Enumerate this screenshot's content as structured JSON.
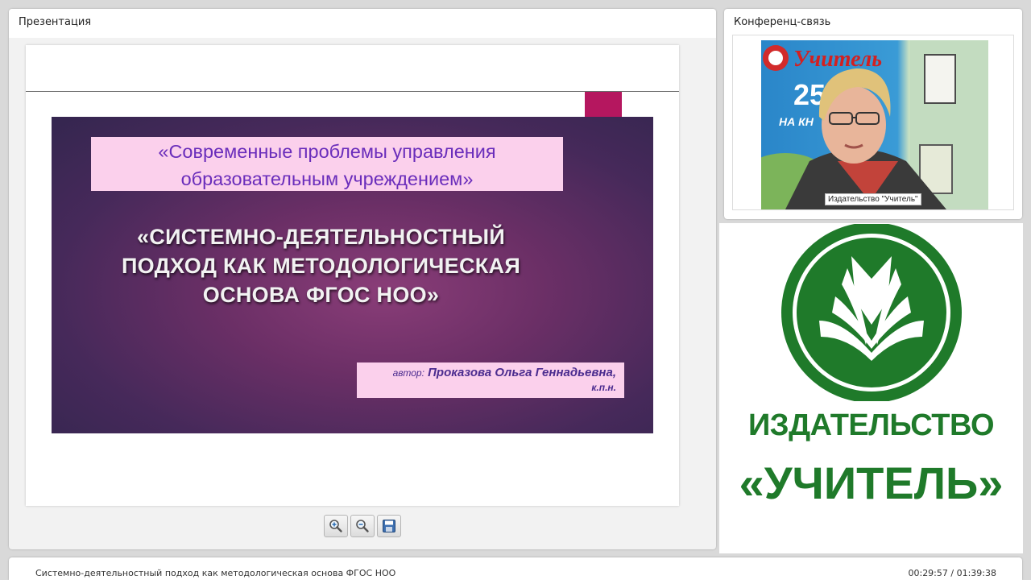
{
  "presentation": {
    "panel_title": "Презентация",
    "slide": {
      "subtitle_line1": "«Современные проблемы управления",
      "subtitle_line2": "образовательным учреждением»",
      "title_line1": "«СИСТЕМНО-ДЕЯТЕЛЬНОСТНЫЙ",
      "title_line2": "ПОДХОД КАК МЕТОДОЛОГИЧЕСКАЯ",
      "title_line3": "ОСНОВА ФГОС НОО»",
      "author_label": "автор:",
      "author_name": "Проказова Ольга Геннадьевна",
      "author_degree": "к.п.н."
    },
    "toolbar": {
      "zoom_in": "zoom-in-icon",
      "zoom_out": "zoom-out-icon",
      "save": "save-icon"
    }
  },
  "conference": {
    "panel_title": "Конференц-связь",
    "video_label": "Издательство \"Учитель\"",
    "background_banner": "Учитель",
    "background_number": "25",
    "background_text": "НА КН"
  },
  "logo": {
    "line1": "ИЗДАТЕЛЬСТВО",
    "line2": "«УЧИТЕЛЬ»",
    "color": "#1f7a2a"
  },
  "status": {
    "title": "Системно-деятельностный подход как методологическая основа ФГОС НОО",
    "time": "00:29:57 / 01:39:38"
  },
  "colors": {
    "slide_accent": "#b5175f",
    "pink_box": "#fbd0ec",
    "subtitle_text": "#6a2dbb"
  }
}
